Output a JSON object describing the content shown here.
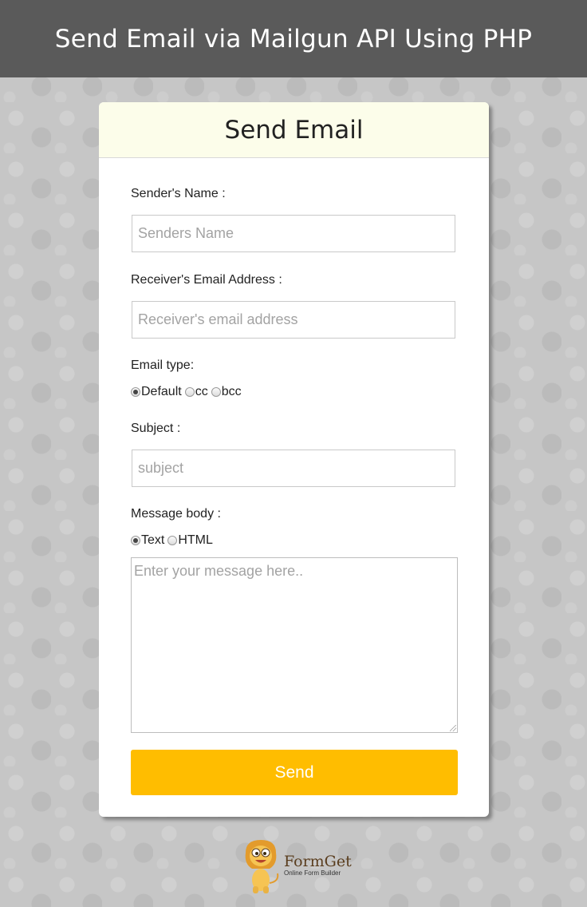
{
  "page": {
    "banner_title": "Send Email via Mailgun API Using PHP"
  },
  "card": {
    "title": "Send Email"
  },
  "form": {
    "sender_name": {
      "label": "Sender's Name :",
      "placeholder": "Senders Name",
      "value": ""
    },
    "receiver_email": {
      "label": "Receiver's Email Address :",
      "placeholder": "Receiver's email address",
      "value": ""
    },
    "email_type": {
      "label": "Email type:",
      "options": [
        "Default",
        "cc",
        "bcc"
      ],
      "selected": "Default"
    },
    "subject": {
      "label": "Subject :",
      "placeholder": "subject",
      "value": ""
    },
    "message_body": {
      "label": "Message body :",
      "options": [
        "Text",
        "HTML"
      ],
      "selected": "Text",
      "placeholder": "Enter your message here.."
    },
    "send_label": "Send"
  },
  "footer": {
    "logo_name": "FormGet",
    "logo_tagline": "Online Form Builder"
  },
  "colors": {
    "banner_bg": "#5a5a5a",
    "card_header_bg": "#fcfdea",
    "send_button": "#ffbd00"
  }
}
